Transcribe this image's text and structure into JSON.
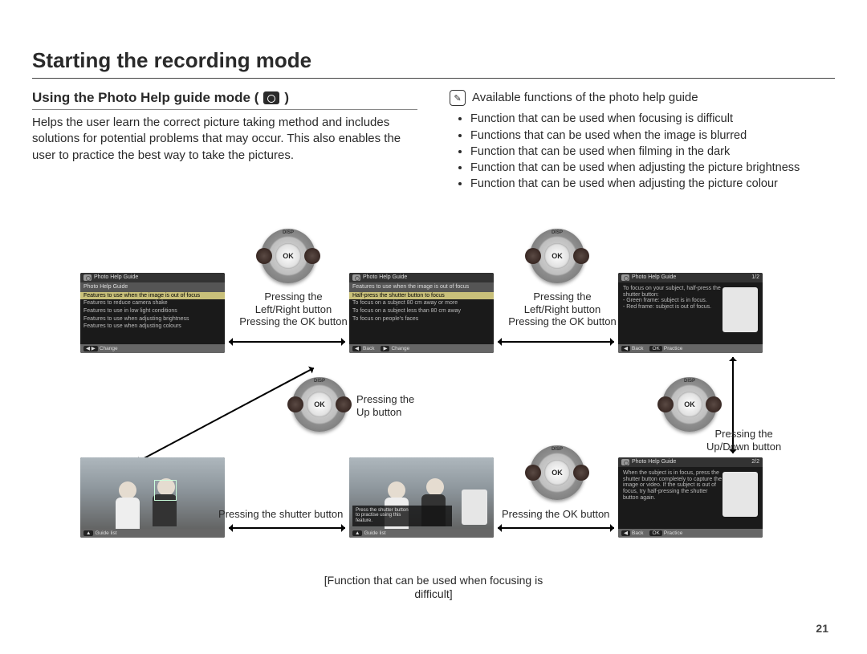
{
  "pageNumber": "21",
  "title": "Starting the recording mode",
  "subheading": "Using the Photo Help guide mode (",
  "subheading_close": ")",
  "intro": "Helps the user learn the correct picture taking method and includes solutions for potential problems that may occur. This also enables the user to practice the best way to take the pictures.",
  "note_title": "Available functions of the photo help guide",
  "bullets": [
    "Function that can be used when focusing is difficult",
    "Functions that can be used when the image is blurred",
    "Function that can be used when filming in the dark",
    "Function that can be used when adjusting the picture brightness",
    "Function that can be used when adjusting the picture colour"
  ],
  "captions": {
    "lr_ok_1": "Pressing the\nLeft/Right button\nPressing the OK button",
    "lr_ok_2": "Pressing the\nLeft/Right button\nPressing the OK button",
    "up": "Pressing the\nUp button",
    "shutter": "Pressing the shutter button",
    "ok": "Pressing the OK button",
    "updown": "Pressing the\nUp/Down button",
    "bottom": "[Function that can be used when focusing is difficult]"
  },
  "screens": {
    "s1": {
      "hdr": "Photo Help Guide",
      "sub": "Photo Help Guide",
      "hi": "Features to use when the image is out of focus",
      "lines": [
        "Features to reduce camera shake",
        "Features to use in low light conditions",
        "Features to use when adjusting brightness",
        "Features to use when adjusting colours"
      ],
      "ftL": "Change",
      "ftLkey": "◀ ▶"
    },
    "s2": {
      "hdr": "Photo Help Guide",
      "sub": "Features to use when the image is out of focus",
      "hi": "Half-press the shutter button to focus",
      "lines": [
        "To focus on a subject 80 cm away or more",
        "To focus on a subject less than 80 cm away",
        "To focus on people's faces"
      ],
      "ftLkey": "◀",
      "ftL": "Back",
      "ftRkey": "▶",
      "ftR": "Change"
    },
    "s3": {
      "hdr": "Photo Help Guide",
      "page": "1/2",
      "body": "To focus on your subject, half-press the shutter button:\n- Green frame: subject is in focus.\n- Red frame: subject is out of focus.",
      "ftLkey": "◀",
      "ftL": "Back",
      "ftRkey": "OK",
      "ftR": "Practice"
    },
    "s6": {
      "hdr": "Photo Help Guide",
      "page": "2/2",
      "body": "When the subject is in focus, press the shutter button completely to capture the image or video. If the subject is out of focus, try half-pressing the shutter button again.",
      "ftLkey": "◀",
      "ftL": "Back",
      "ftRkey": "OK",
      "ftR": "Practice"
    },
    "s4": {
      "ft": "Guide list",
      "ftkey": "▲"
    },
    "s5": {
      "overlay": "Press the shutter button\nto practise using this\nfeature.",
      "ft": "Guide list",
      "ftkey": "▲"
    }
  }
}
